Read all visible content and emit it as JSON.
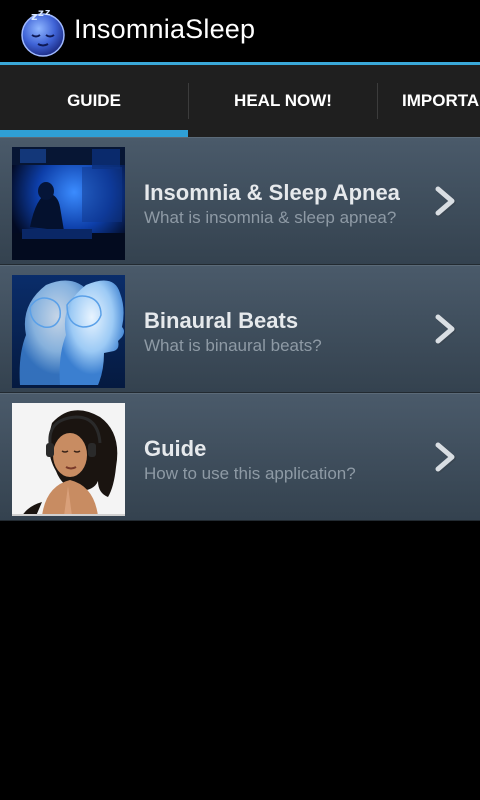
{
  "app": {
    "title": "InsomniaSleep",
    "icon": "sleepy-moon-face-icon"
  },
  "tabs": [
    {
      "label": "GUIDE",
      "selected": true
    },
    {
      "label": "HEAL NOW!",
      "selected": false
    },
    {
      "label": "IMPORTANT",
      "selected": false
    }
  ],
  "colors": {
    "accent": "#2f9fd6",
    "list_bg_top": "#4a5a6a",
    "list_bg_bottom": "#34424f",
    "title_text": "#e6e9ec",
    "subtitle_text": "#8e9aa5"
  },
  "items": [
    {
      "title": "Insomnia & Sleep Apnea",
      "subtitle": "What is insomnia & sleep apnea?",
      "thumbnail": "dark-blue-bedroom-image"
    },
    {
      "title": "Binaural Beats",
      "subtitle": "What is binaural beats?",
      "thumbnail": "glowing-brain-heads-image"
    },
    {
      "title": "Guide",
      "subtitle": "How to use this application?",
      "thumbnail": "woman-with-headphones-image"
    }
  ]
}
